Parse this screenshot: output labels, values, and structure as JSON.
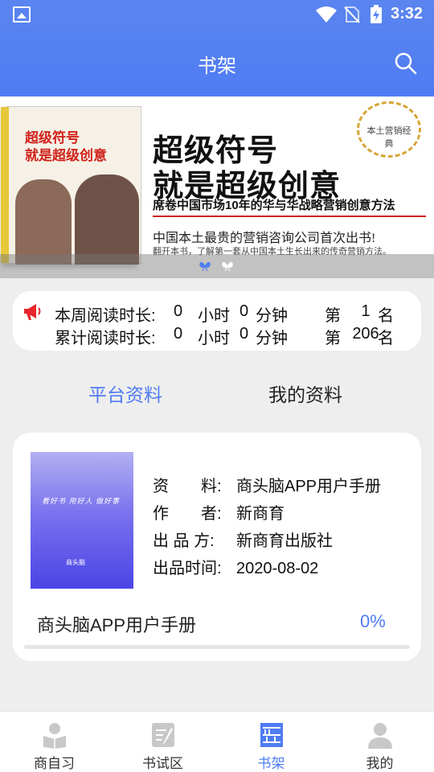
{
  "status_bar": {
    "time": "3:32"
  },
  "header": {
    "title": "书架"
  },
  "banner": {
    "book_title_line1": "超级符号",
    "book_title_line2": "就是超级创意",
    "headline_line1": "超级符号",
    "headline_line2": "就是超级创意",
    "subtitle": "席卷中国市场10年的华与华战略营销创意方法",
    "seal_text": "本土营销经典",
    "tagline": "中国本土最贵的营销咨询公司首次出书!",
    "description": "翻开本书，了解第一套从中国本土生长出来的传奇营销方法。"
  },
  "stats": {
    "weekly": {
      "label": "本周阅读时长:",
      "hours": "0",
      "hours_unit": "小时",
      "minutes": "0",
      "minutes_unit": "分钟",
      "rank_prefix": "第",
      "rank": "1",
      "rank_suffix": "名"
    },
    "total": {
      "label": "累计阅读时长:",
      "hours": "0",
      "hours_unit": "小时",
      "minutes": "0",
      "minutes_unit": "分钟",
      "rank_prefix": "第",
      "rank": "206",
      "rank_suffix": "名"
    }
  },
  "tabs": {
    "platform": "平台资料",
    "mine": "我的资料"
  },
  "book": {
    "cover_slogan": "看好书 用好人 做好事",
    "cover_logo": "商头脑",
    "fields": [
      {
        "key": "资　　料:",
        "value": "商头脑APP用户手册"
      },
      {
        "key": "作　　者:",
        "value": "新商育"
      },
      {
        "key": "出 品 方:",
        "value": "新商育出版社"
      },
      {
        "key": "出品时间:",
        "value": "2020-08-02"
      }
    ],
    "name": "商头脑APP用户手册",
    "progress_text": "0%",
    "progress_fraction": 0
  },
  "bottom_nav": [
    {
      "label": "商自习",
      "icon": "reader-icon"
    },
    {
      "label": "书试区",
      "icon": "exam-icon"
    },
    {
      "label": "书架",
      "icon": "bookshelf-icon",
      "active": true
    },
    {
      "label": "我的",
      "icon": "person-icon"
    }
  ],
  "colors": {
    "accent": "#4f7cf2",
    "alert": "#e8262c"
  }
}
